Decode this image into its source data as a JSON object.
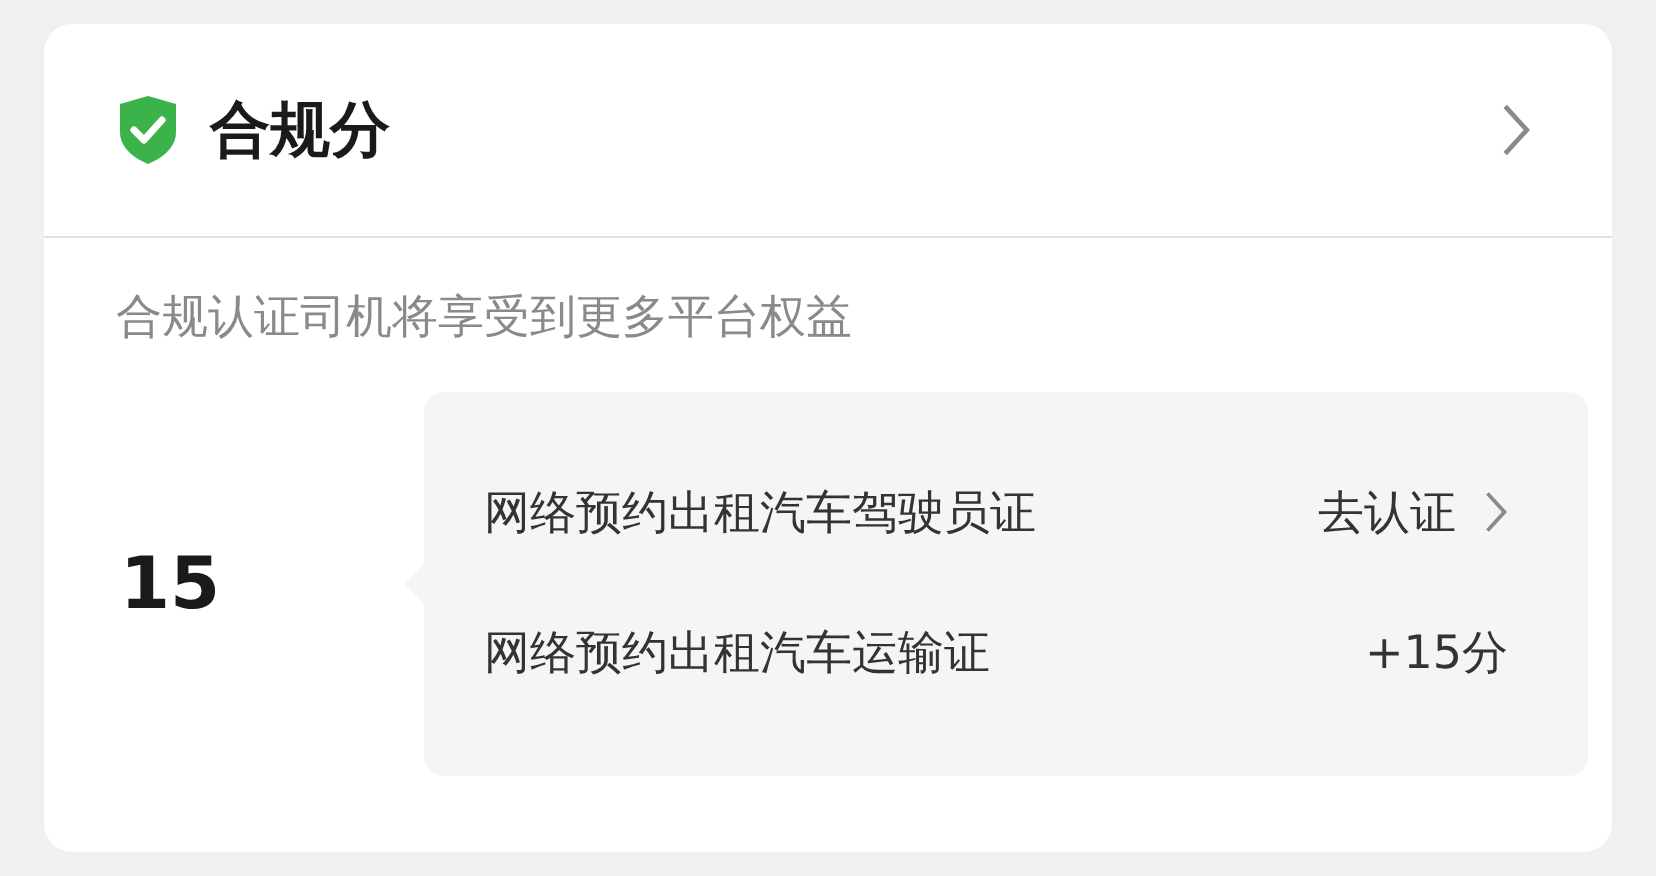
{
  "card": {
    "title": "合规分",
    "subtitle": "合规认证司机将享受到更多平台权益",
    "score": "15",
    "items": [
      {
        "name": "网络预约出租汽车驾驶员证",
        "kind": "link",
        "action": "去认证"
      },
      {
        "name": "网络预约出租汽车运输证",
        "kind": "points",
        "action": "+15分"
      }
    ]
  }
}
